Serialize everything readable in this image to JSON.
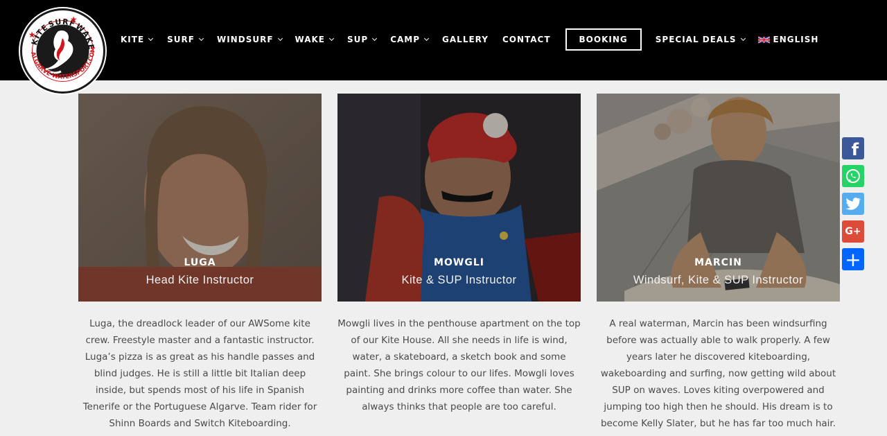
{
  "logo": {
    "text_top_left": "KITE",
    "text_top_mid": "SURF",
    "text_top_right": "WAKE",
    "text_bottom": "ALGARVE-WATERSPORT.COM"
  },
  "nav": {
    "items": [
      {
        "label": "KITE",
        "dropdown": true
      },
      {
        "label": "SURF",
        "dropdown": true
      },
      {
        "label": "WINDSURF",
        "dropdown": true
      },
      {
        "label": "WAKE",
        "dropdown": true
      },
      {
        "label": "SUP",
        "dropdown": true
      },
      {
        "label": "CAMP",
        "dropdown": true
      },
      {
        "label": "GALLERY",
        "dropdown": false
      },
      {
        "label": "CONTACT",
        "dropdown": false
      }
    ],
    "booking": "BOOKING",
    "special_deals": "SPECIAL DEALS",
    "language": "ENGLISH"
  },
  "team": [
    {
      "name": "LUGA",
      "role": "Head Kite Instructor",
      "description": "Luga, the dreadlock leader of our AWSome kite crew. Freestyle master and a fantastic instructor. Luga’s pizza is as great as his handle passes and blind judges. He is still a little bit Italian deep inside, but spends most of his life in Spanish Tenerife or the Portuguese Algarve. Team rider for Shinn Boards and Switch Kiteboarding."
    },
    {
      "name": "MOWGLI",
      "role": "Kite & SUP Instructor",
      "description": "Mowgli lives in the penthouse apartment on the top of our Kite House. All she needs in life is wind, water, a skateboard, a sketch book and some paint. She brings colour to our lifes. Mowgli loves painting and drinks more coffee than water. She always thinks that people are too careful."
    },
    {
      "name": "MARCIN",
      "role": "Windsurf, Kite & SUP Instructor",
      "description": "A real waterman, Marcin has been windsurfing before was actually able to walk properly. A few years later he discovered kiteboarding, wakeboarding and surfing, now getting wild about SUP on waves. Loves kiting overpowered and jumping too high then he should. His dream is to become Kelly Slater, but he has far too much hair."
    }
  ],
  "social": [
    {
      "icon": "facebook-icon",
      "glyph": "f",
      "color": "#3b5998"
    },
    {
      "icon": "whatsapp-icon",
      "glyph": "",
      "color": "#25d366"
    },
    {
      "icon": "twitter-icon",
      "glyph": "",
      "color": "#55acee"
    },
    {
      "icon": "google-plus-icon",
      "glyph": "G+",
      "color": "#dd4b39"
    },
    {
      "icon": "share-icon",
      "glyph": "+",
      "color": "#0166ff"
    }
  ]
}
